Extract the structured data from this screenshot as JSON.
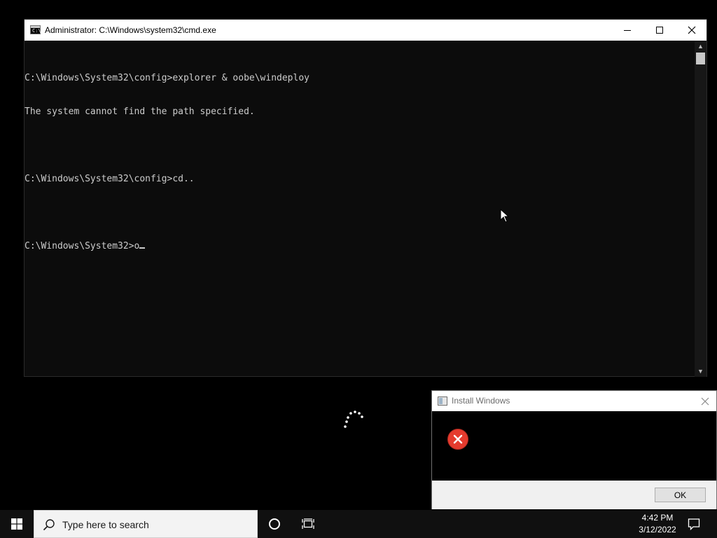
{
  "cmd_window": {
    "title": "Administrator: C:\\Windows\\system32\\cmd.exe",
    "icon": "cmd-icon",
    "icon_text": "C:\\",
    "controls": [
      "minimize-icon",
      "maximize-icon",
      "close-icon"
    ],
    "lines": [
      "C:\\Windows\\System32\\config>explorer & oobe\\windeploy",
      "The system cannot find the path specified.",
      "",
      "C:\\Windows\\System32\\config>cd..",
      "",
      "C:\\Windows\\System32>o"
    ],
    "colors": {
      "background": "#0c0c0c",
      "text": "#cccccc"
    }
  },
  "dialog": {
    "title": "Install Windows",
    "icon": "error-icon",
    "ok_label": "OK",
    "colors": {
      "error": "#e53b2e"
    }
  },
  "taskbar": {
    "search_placeholder": "Type here to search",
    "time": "4:42 PM",
    "date": "3/12/2022",
    "icons": [
      "windows-start-icon",
      "search-icon",
      "cortana-icon",
      "task-view-icon",
      "notification-icon"
    ],
    "colors": {
      "background": "#101010",
      "start": "#ffffff"
    }
  }
}
